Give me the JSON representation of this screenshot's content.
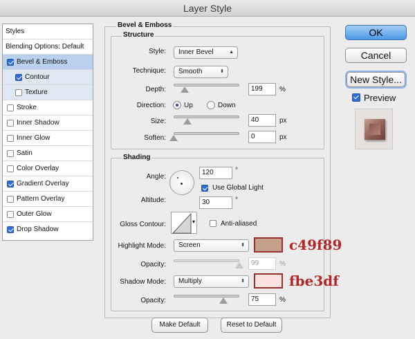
{
  "window": {
    "title": "Layer Style"
  },
  "colors": {
    "highlight": "#c49f89",
    "shadow": "#fbe3df",
    "accent": "#4b97e6"
  },
  "sidebar": {
    "header": "Styles",
    "items": [
      {
        "label": "Blending Options: Default",
        "checkbox": false,
        "checked": false
      },
      {
        "label": "Bevel & Emboss",
        "checkbox": true,
        "checked": true,
        "selected": true
      },
      {
        "label": "Contour",
        "checkbox": true,
        "checked": true
      },
      {
        "label": "Texture",
        "checkbox": true,
        "checked": false
      },
      {
        "label": "Stroke",
        "checkbox": true,
        "checked": false
      },
      {
        "label": "Inner Shadow",
        "checkbox": true,
        "checked": false
      },
      {
        "label": "Inner Glow",
        "checkbox": true,
        "checked": false
      },
      {
        "label": "Satin",
        "checkbox": true,
        "checked": false
      },
      {
        "label": "Color Overlay",
        "checkbox": true,
        "checked": false
      },
      {
        "label": "Gradient Overlay",
        "checkbox": true,
        "checked": true
      },
      {
        "label": "Pattern Overlay",
        "checkbox": true,
        "checked": false
      },
      {
        "label": "Outer Glow",
        "checkbox": true,
        "checked": false
      },
      {
        "label": "Drop Shadow",
        "checkbox": true,
        "checked": true
      }
    ]
  },
  "bevel": {
    "section_title": "Bevel & Emboss",
    "structure_title": "Structure",
    "style_label": "Style:",
    "style_value": "Inner Bevel",
    "technique_label": "Technique:",
    "technique_value": "Smooth",
    "depth_label": "Depth:",
    "depth_value": "199",
    "depth_unit": "%",
    "direction_label": "Direction:",
    "dir_up": "Up",
    "dir_down": "Down",
    "direction_selected": "Up",
    "size_label": "Size:",
    "size_value": "40",
    "size_unit": "px",
    "soften_label": "Soften:",
    "soften_value": "0",
    "soften_unit": "px"
  },
  "shading": {
    "title": "Shading",
    "angle_label": "Angle:",
    "angle_value": "120",
    "angle_unit": "°",
    "global_light_label": "Use Global Light",
    "global_light": true,
    "altitude_label": "Altitude:",
    "altitude_value": "30",
    "altitude_unit": "°",
    "gloss_label": "Gloss Contour:",
    "anti_aliased_label": "Anti-aliased",
    "anti_aliased": false,
    "highlight_mode_label": "Highlight Mode:",
    "highlight_mode": "Screen",
    "highlight_opacity_label": "Opacity:",
    "highlight_opacity": "99",
    "highlight_opacity_unit": "%",
    "shadow_mode_label": "Shadow Mode:",
    "shadow_mode": "Multiply",
    "shadow_opacity_label": "Opacity:",
    "shadow_opacity": "75",
    "shadow_opacity_unit": "%"
  },
  "annotations": {
    "highlight_hex": "c49f89",
    "shadow_hex": "fbe3df"
  },
  "footer": {
    "make_default": "Make Default",
    "reset_default": "Reset to Default"
  },
  "actions": {
    "ok": "OK",
    "cancel": "Cancel",
    "new_style": "New Style...",
    "preview": "Preview",
    "preview_checked": true
  }
}
